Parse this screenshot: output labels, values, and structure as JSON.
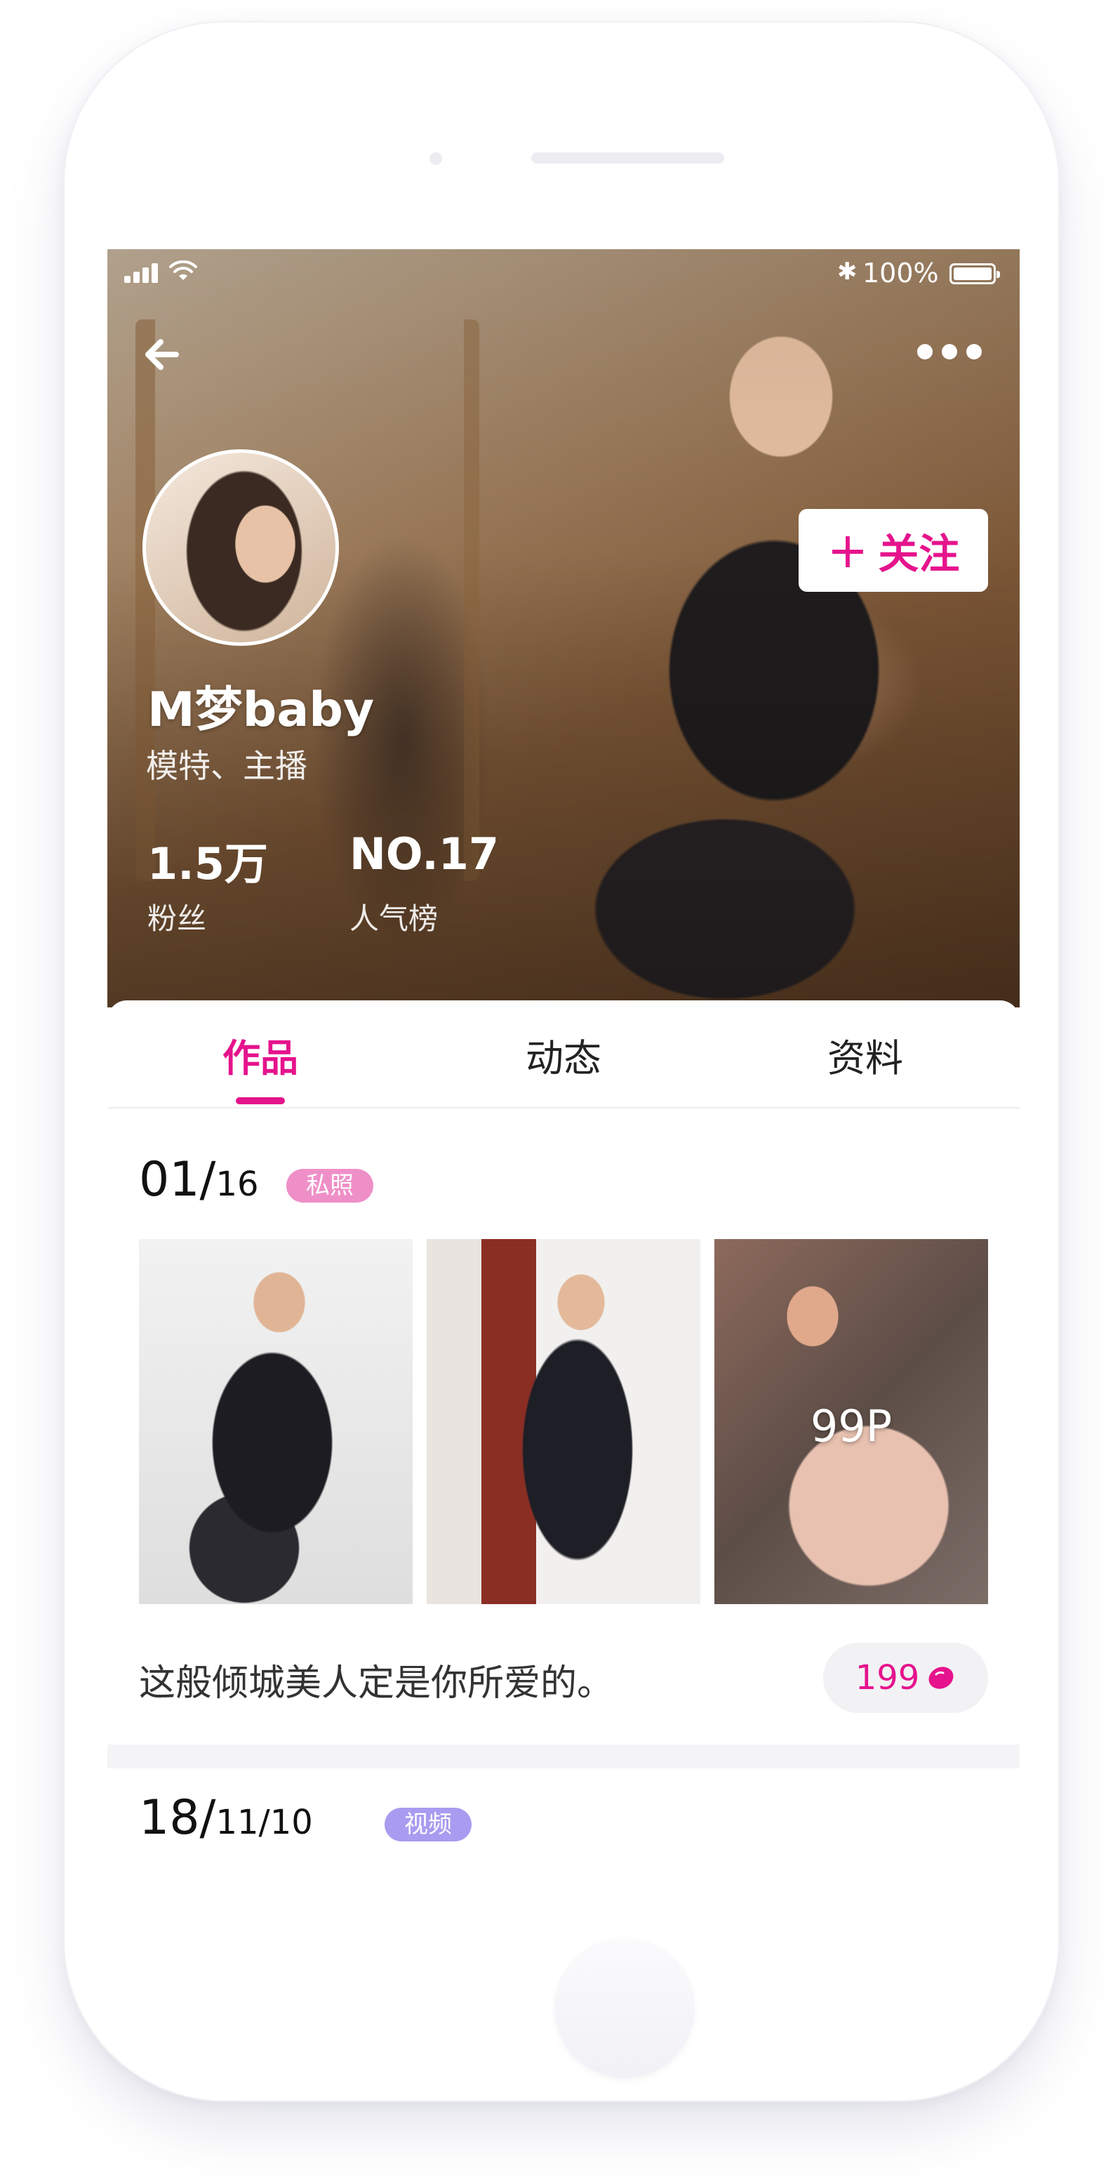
{
  "status_bar": {
    "battery": "100%",
    "icons": [
      "signal-icon",
      "wifi-icon",
      "bluetooth-icon",
      "battery-icon"
    ]
  },
  "header": {
    "back_icon": "arrow-left-icon",
    "more_icon": "more-dots-icon",
    "follow_plus": "+",
    "follow_label": "关注"
  },
  "profile": {
    "name": "M梦baby",
    "subtitle": "模特、主播",
    "stats": [
      {
        "value": "1.5万",
        "label": "粉丝"
      },
      {
        "value": "NO.17",
        "label": "人气榜"
      }
    ]
  },
  "tabs": [
    {
      "label": "作品",
      "active": true
    },
    {
      "label": "动态",
      "active": false
    },
    {
      "label": "资料",
      "active": false
    }
  ],
  "posts": [
    {
      "date_main": "01/",
      "date_sub": "16",
      "badge": "私照",
      "photo_count": "99P",
      "caption": "这般倾城美人定是你所爱的。",
      "likes": "199"
    },
    {
      "date_main": "18/",
      "date_sub": "11/10",
      "badge": "视频"
    }
  ],
  "colors": {
    "accent": "#e5138c",
    "badge_private": "#ef8fc8",
    "badge_video": "#a99bf0"
  }
}
